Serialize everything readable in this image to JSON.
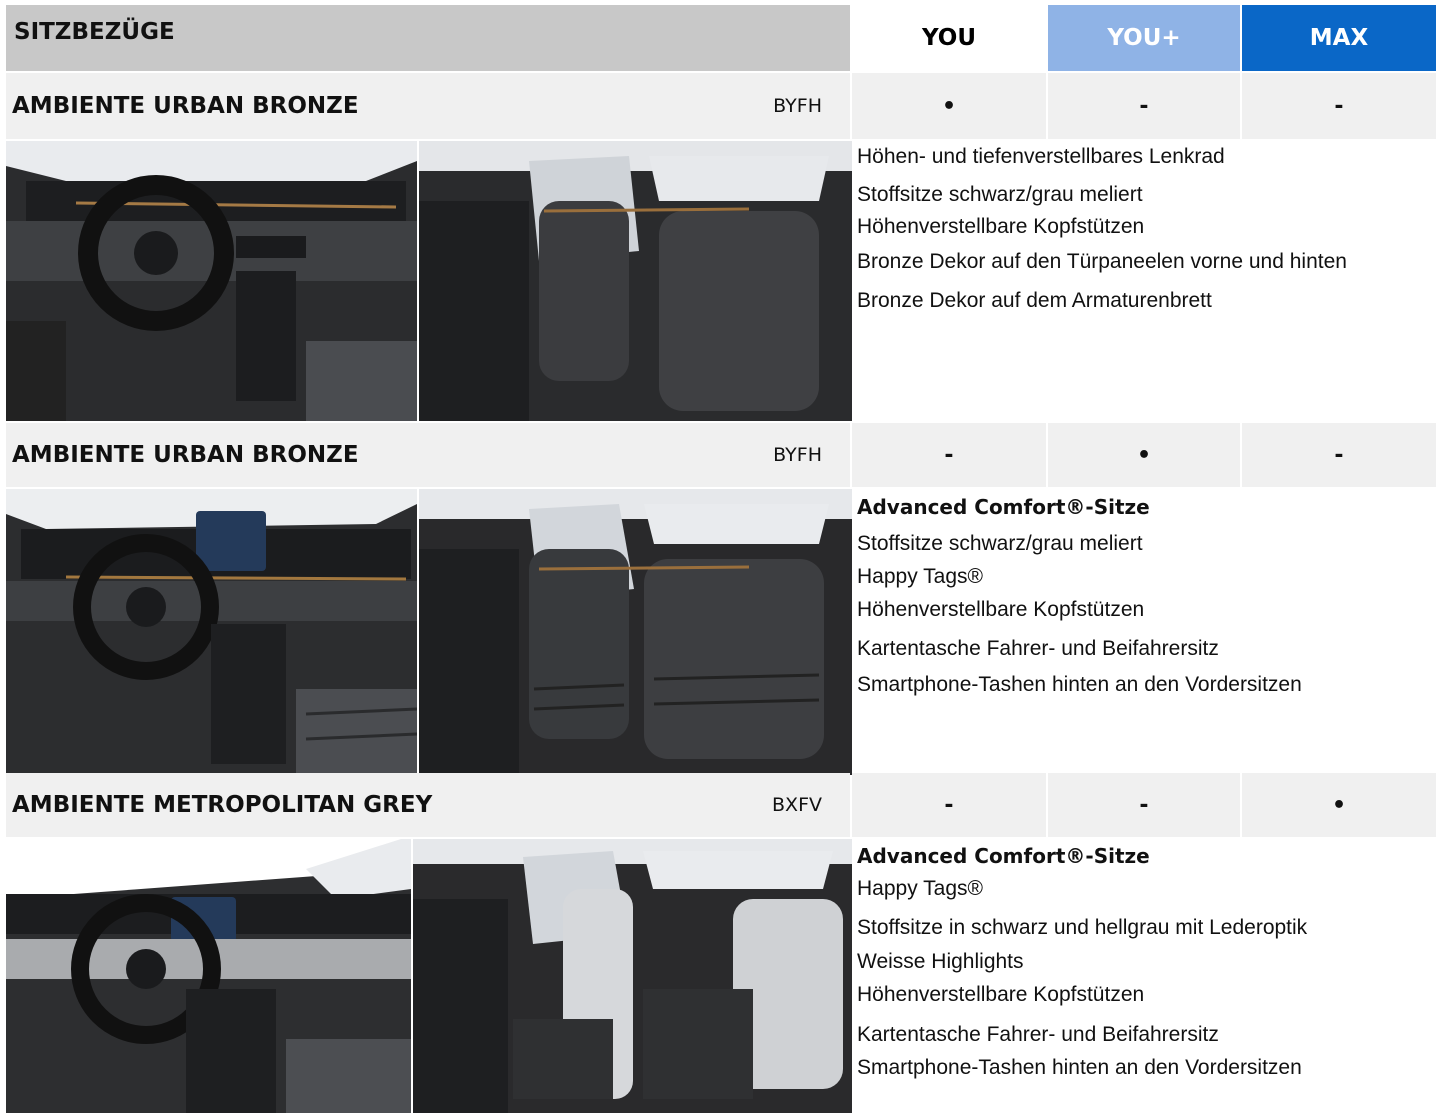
{
  "header": {
    "title": "SITZBEZÜGE",
    "tiers": [
      "YOU",
      "YOU+",
      "MAX"
    ],
    "colors": {
      "header_gray": "#c8c8c8",
      "you_plus": "#8fb3e6",
      "max": "#0a67c7",
      "row_band": "#f0f0f0"
    }
  },
  "rows": [
    {
      "name": "AMBIENTE URBAN BRONZE",
      "code": "BYFH",
      "availability": [
        "•",
        "-",
        "-"
      ],
      "features": [
        {
          "text": "Höhen- und tiefenverstellbares Lenkrad",
          "bold": false
        },
        {
          "text": "Stoffsitze schwarz/grau meliert",
          "bold": false
        },
        {
          "text": "Höhenverstellbare Kopfstützen",
          "bold": false
        },
        {
          "text": "Bronze Dekor auf den Türpaneelen vorne und hinten",
          "bold": false
        },
        {
          "text": "Bronze Dekor auf dem Armaturenbrett",
          "bold": false
        }
      ]
    },
    {
      "name": "AMBIENTE URBAN BRONZE",
      "code": "BYFH",
      "availability": [
        "-",
        "•",
        "-"
      ],
      "features": [
        {
          "text": "Advanced Comfort®-Sitze",
          "bold": true
        },
        {
          "text": "Stoffsitze schwarz/grau meliert",
          "bold": false
        },
        {
          "text": "Happy Tags®",
          "bold": false
        },
        {
          "text": "Höhenverstellbare Kopfstützen",
          "bold": false
        },
        {
          "text": "Kartentasche Fahrer- und Beifahrersitz",
          "bold": false
        },
        {
          "text": "Smartphone-Tashen hinten an den Vordersitzen",
          "bold": false
        }
      ]
    },
    {
      "name": "AMBIENTE METROPOLITAN GREY",
      "code": "BXFV",
      "availability": [
        "-",
        "-",
        "•"
      ],
      "features": [
        {
          "text": "Advanced Comfort®-Sitze",
          "bold": true
        },
        {
          "text": "Happy Tags®",
          "bold": false
        },
        {
          "text": "Stoffsitze in schwarz und hellgrau mit Lederoptik",
          "bold": false
        },
        {
          "text": "Weisse Highlights",
          "bold": false
        },
        {
          "text": "Höhenverstellbare Kopfstützen",
          "bold": false
        },
        {
          "text": "Kartentasche Fahrer- und Beifahrersitz",
          "bold": false
        },
        {
          "text": "Smartphone-Tashen hinten an den Vordersitzen",
          "bold": false
        }
      ]
    }
  ]
}
